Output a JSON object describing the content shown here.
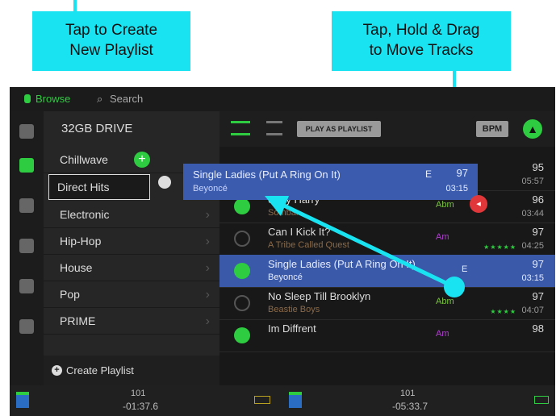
{
  "callouts": {
    "create": {
      "line1": "Tap to Create",
      "line2": "New Playlist"
    },
    "drag": {
      "line1": "Tap, Hold & Drag",
      "line2": "to Move Tracks"
    }
  },
  "topbar": {
    "browse": "Browse",
    "search": "Search"
  },
  "left": {
    "drive": "32GB DRIVE",
    "playlists": [
      {
        "label": "Chillwave"
      },
      {
        "label": "Direct Hits"
      },
      {
        "label": "Electronic"
      },
      {
        "label": "Hip-Hop"
      },
      {
        "label": "House"
      },
      {
        "label": "Pop"
      },
      {
        "label": "PRIME"
      }
    ],
    "create_label": "Create Playlist"
  },
  "header": {
    "play_as_playlist": "PLAY AS PLAYLIST",
    "bpm": "BPM"
  },
  "dragged": {
    "title": "Single Ladies (Put A Ring On It)",
    "artist": "Beyoncé",
    "key": "E",
    "bpm": "97",
    "time": "03:15"
  },
  "tracks": [
    {
      "title": "",
      "artist": "",
      "key": "",
      "bpm": "95",
      "time": "05:57",
      "stars": ""
    },
    {
      "title": "Sexy Harry",
      "artist": "Sombar",
      "key": "Abm",
      "bpm": "96",
      "time": "03:44",
      "stars": ""
    },
    {
      "title": "Can I Kick It?",
      "artist": "A Tribe Called Quest",
      "key": "Am",
      "bpm": "97",
      "time": "04:25",
      "stars": "★★★★★"
    },
    {
      "title": "Single Ladies (Put A Ring On It)",
      "artist": "Beyoncé",
      "key": "E",
      "bpm": "97",
      "time": "03:15",
      "stars": ""
    },
    {
      "title": "No Sleep Till Brooklyn",
      "artist": "Beastie Boys",
      "key": "Abm",
      "bpm": "97",
      "time": "04:07",
      "stars": "★★★★"
    },
    {
      "title": "Im Diffrent",
      "artist": "",
      "key": "Am",
      "bpm": "98",
      "time": "",
      "stars": ""
    }
  ],
  "bottom": {
    "left_bpm": "101",
    "left_time": "-01:37.6",
    "right_bpm": "101",
    "right_time": "-05:33.7"
  },
  "colors": {
    "accent": "#19e3f0",
    "green": "#2ecc40",
    "selected": "#3a59a8"
  }
}
